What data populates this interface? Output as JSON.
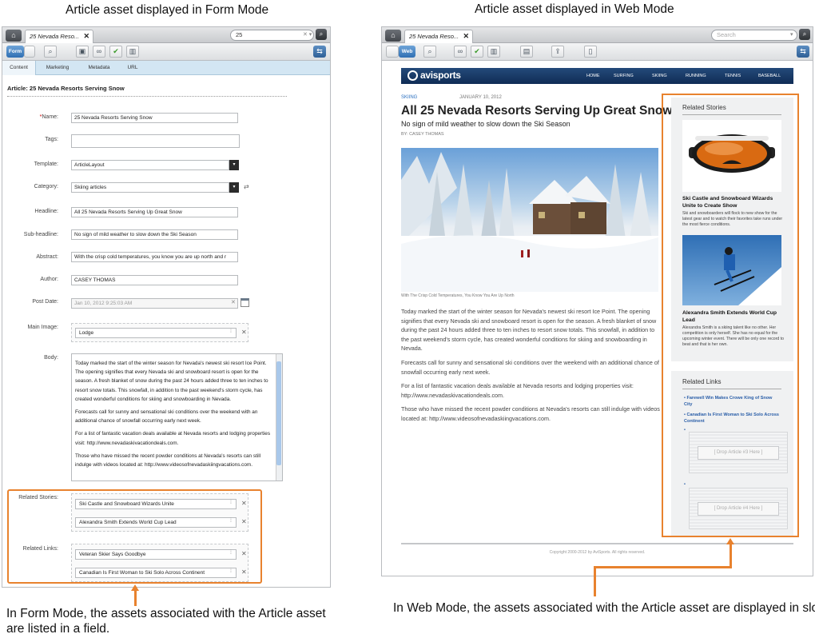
{
  "captions": {
    "form_title": "Article asset displayed in Form Mode",
    "web_title": "Article asset displayed in Web Mode",
    "form_note_line1": "In Form Mode, the assets associated with the Article asset",
    "form_note_line2": "are listed in a field.",
    "web_note": "In Web Mode, the assets associated with the Article asset are displayed in slots."
  },
  "form_panel": {
    "tab_label": "25 Nevada Reso...",
    "search_value": "25",
    "mode_label": "Form",
    "subtabs": [
      "Content",
      "Marketing",
      "Metadata",
      "URL"
    ],
    "heading": "Article: 25 Nevada Resorts Serving Snow",
    "fields": {
      "name_label": "Name:",
      "name_required": "*",
      "name_value": "25 Nevada Resorts Serving Snow",
      "tags_label": "Tags:",
      "tags_value": "",
      "template_label": "Template:",
      "template_value": "ArticleLayout",
      "category_label": "Category:",
      "category_value": "Skiing articles",
      "headline_label": "Headline:",
      "headline_value": "All 25 Nevada Resorts Serving Up Great Snow",
      "subheadline_label": "Sub-headline:",
      "subheadline_value": "No sign of mild weather to slow down the Ski Season",
      "abstract_label": "Abstract:",
      "abstract_value": "With the crisp cold temperatures, you know you are up north and r",
      "author_label": "Author:",
      "author_value": "CASEY THOMAS",
      "postdate_label": "Post Date:",
      "postdate_value": "Jan 10, 2012 9:25:03 AM",
      "mainimage_label": "Main Image:",
      "mainimage_value": "Lodge",
      "body_label": "Body:",
      "body_paragraphs": [
        "Today marked the start of the winter season for Nevada's newest ski resort Ice Point. The opening signifies that every Nevada ski and snowboard resort is open for the season. A fresh blanket of snow during the past 24 hours added three to ten inches to resort snow totals. This snowfall, in addition to the past weekend's storm cycle, has created wonderful conditions for skiing and snowboarding in Nevada.",
        "Forecasts call for sunny and sensational ski conditions over the weekend with an additional chance of snowfall occurring early next week.",
        "For a list of fantastic vacation deals available at Nevada resorts and lodging properties visit: http://www.nevadaskivacationdeals.com.",
        "Those who have missed the recent powder conditions at Nevada's resorts can still indulge with videos located at: http://www.videosofnevadaskiingvacations.com."
      ],
      "related_stories_label": "Related Stories:",
      "related_stories": [
        "Ski Castle and Snowboard Wizards Unite",
        "Alexandra Smith Extends World Cup Lead"
      ],
      "related_links_label": "Related Links:",
      "related_links": [
        "Veteran Skier Says Goodbye",
        "Canadian Is First Woman to Ski Solo Across Continent"
      ]
    }
  },
  "web_panel": {
    "tab_label": "25 Nevada Reso...",
    "search_placeholder": "Search",
    "mode_label": "Web",
    "site": {
      "logo": "avisports",
      "nav": [
        "HOME",
        "SURFING",
        "SKIING",
        "RUNNING",
        "TENNIS",
        "BASEBALL"
      ]
    },
    "article": {
      "section": "SKIING",
      "date": "JANUARY 10, 2012",
      "headline": "All 25 Nevada Resorts Serving Up Great Snow",
      "subheadline": "No sign of mild weather to slow down the Ski Season",
      "byline": "BY: CASEY THOMAS",
      "image_caption": "With The Crisp Cold Temperatures, You Know You Are Up North",
      "paragraphs": [
        "Today marked the start of the winter season for Nevada's newest ski resort Ice Point. The opening signifies that every Nevada ski and snowboard resort is open for the season. A fresh blanket of snow during the past 24 hours added three to ten inches to resort snow totals. This snowfall, in addition to the past weekend's storm cycle, has created wonderful conditions for skiing and snowboarding in Nevada.",
        "Forecasts call for sunny and sensational ski conditions over the weekend with an additional chance of snowfall occurring early next week.",
        "For a list of fantastic vacation deals available at Nevada resorts and lodging properties visit: http://www.nevadaskivacationdeals.com.",
        "Those who have missed the recent powder conditions at Nevada's resorts can still indulge with videos located at: http://www.videosofnevadaskiingvacations.com."
      ]
    },
    "sidebar": {
      "related_stories_title": "Related Stories",
      "story1_title": "Ski Castle and Snowboard Wizards Unite to Create Show",
      "story1_body": "Ski and snowboarders will flock to new show for the latest gear and to watch their favorites take runs under the most fierce conditions.",
      "story2_title": "Alexandra Smith Extends World Cup Lead",
      "story2_body": "Alexandra Smith is a skiing talent like no other. Her competition is only herself. She has no equal for the upcoming winter event. There will be only one record to beat and that is her own.",
      "related_links_title": "Related Links",
      "links": [
        "Farewell Win Makes Crowe King of Snow City",
        "Canadian Is First Woman to Ski Solo Across Continent"
      ],
      "slot3_label": "[ Drop Article #3 Here ]",
      "slot4_label": "[ Drop Article #4 Here ]"
    },
    "footer": "Copyright 2000-2012 by AviSports. All rights reserved."
  },
  "colors": {
    "highlight": "#e8822e",
    "nav_bg": "#16355f",
    "link": "#2a5ea8"
  },
  "icons": [
    "home-icon",
    "search-icon",
    "close-icon",
    "sync-icon",
    "binoculars-icon",
    "save-icon",
    "approve-icon",
    "delete-icon",
    "calendar-icon",
    "dropdown-icon"
  ]
}
